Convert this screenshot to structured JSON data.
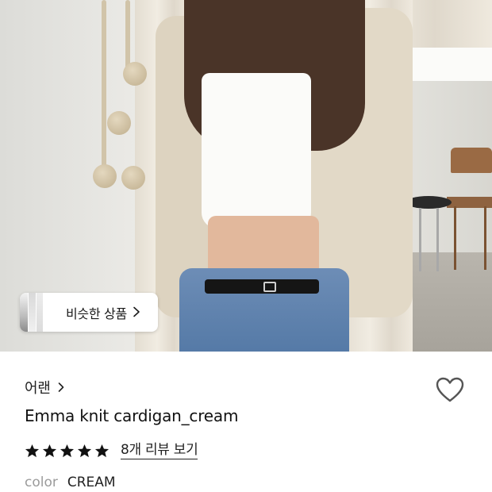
{
  "hero": {
    "similar_products_label": "비슷한 상품"
  },
  "product": {
    "brand": "어랜",
    "title": "Emma knit cardigan_cream",
    "rating_stars": 5,
    "reviews_link": "8개 리뷰 보기",
    "option": {
      "key": "color",
      "value": "CREAM"
    }
  },
  "icons": {
    "similar_arrow": "chevron-right-icon",
    "brand_arrow": "chevron-right-icon",
    "wishlist": "heart-outline-icon",
    "star": "star-filled-icon"
  },
  "colors": {
    "text_primary": "#111111",
    "text_muted": "#9b9b9b",
    "star": "#111111",
    "heart_outline": "#555555"
  }
}
